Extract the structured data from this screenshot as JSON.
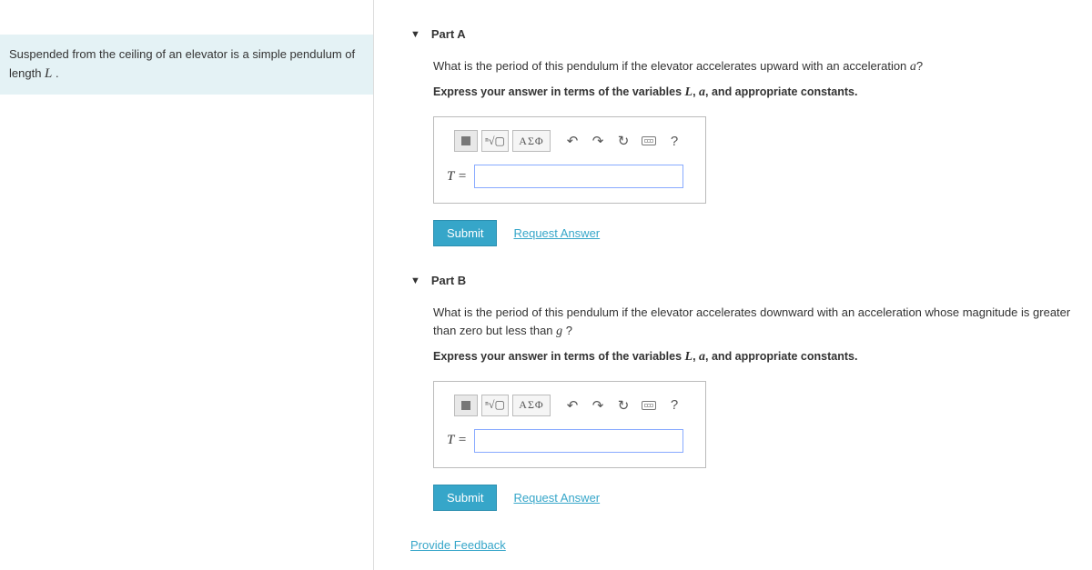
{
  "problem": {
    "text_before": "Suspended from the ceiling of an elevator is a simple pendulum of length ",
    "var1": "L",
    "text_after": " ."
  },
  "parts": [
    {
      "title": "Part A",
      "question_before": "What is the period of this pendulum if the elevator accelerates upward with an acceleration ",
      "question_var": "a",
      "question_after": "?",
      "instruction_before": "Express your answer in terms of the variables ",
      "instruction_var1": "L",
      "instruction_mid": ", ",
      "instruction_var2": "a",
      "instruction_after": ", and appropriate constants.",
      "input_label": "T =",
      "submit_label": "Submit",
      "request_answer_label": "Request Answer"
    },
    {
      "title": "Part B",
      "question_before": "What is the period of this pendulum if the elevator accelerates downward with an acceleration whose magnitude is greater than zero but less than ",
      "question_var": "g",
      "question_after": " ?",
      "instruction_before": "Express your answer in terms of the variables ",
      "instruction_var1": "L",
      "instruction_mid": ", ",
      "instruction_var2": "a",
      "instruction_after": ", and appropriate constants.",
      "input_label": "T =",
      "submit_label": "Submit",
      "request_answer_label": "Request Answer"
    }
  ],
  "toolbar": {
    "greek_label": "ΑΣΦ",
    "help_label": "?"
  },
  "feedback_label": "Provide Feedback"
}
